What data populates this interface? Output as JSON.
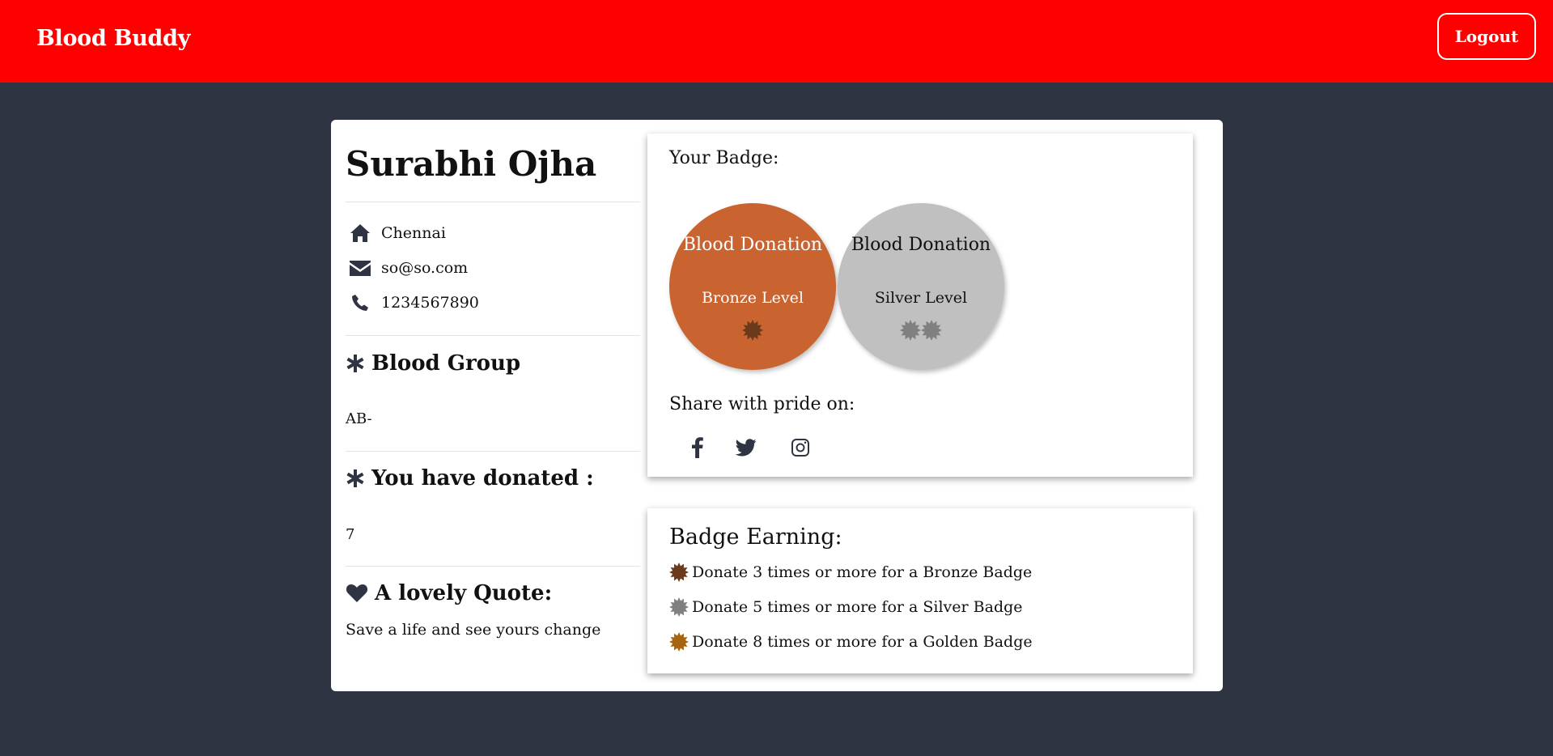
{
  "app": {
    "brand": "Blood Buddy",
    "logout_label": "Logout",
    "accent_color": "#ff0000"
  },
  "profile": {
    "name": "Surabhi Ojha",
    "city": "Chennai",
    "email": "so@so.com",
    "phone": "1234567890",
    "blood_group_title": "Blood Group",
    "blood_group": "AB-",
    "donated_title": "You have donated :",
    "donated_count": "7",
    "quote_title": "A lovely Quote:",
    "quote": "Save a life and see yours change"
  },
  "badges": {
    "title": "Your Badge:",
    "items": [
      {
        "title": "Blood Donation",
        "level": "Bronze Level",
        "stars": 1,
        "color": "#c96431",
        "star_color": "#6b3a1c"
      },
      {
        "title": "Blood Donation",
        "level": "Silver Level",
        "stars": 2,
        "color": "#c0c0c0",
        "star_color": "#808080"
      }
    ],
    "share_label": "Share with pride on:",
    "social_icons": [
      "facebook-icon",
      "twitter-icon",
      "instagram-icon"
    ]
  },
  "earning": {
    "title": "Badge Earning:",
    "rules": [
      {
        "text": "Donate 3 times or more for a Bronze Badge",
        "star_color": "#6b3a1c"
      },
      {
        "text": "Donate 5 times or more for a Silver Badge",
        "star_color": "#808080"
      },
      {
        "text": "Donate 8 times or more for a Golden Badge",
        "star_color": "#a8650f"
      }
    ]
  }
}
